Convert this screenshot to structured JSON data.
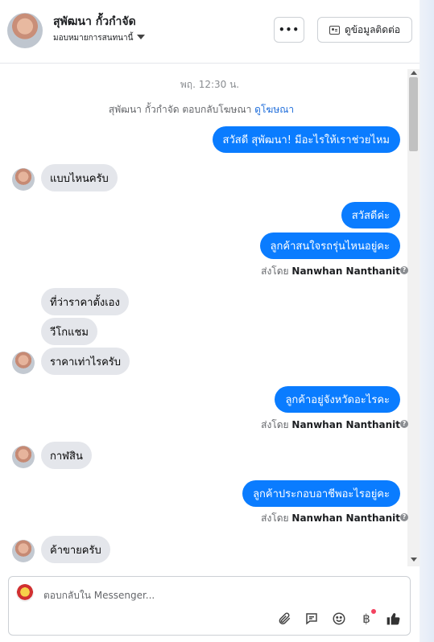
{
  "header": {
    "name": "สุพัฒนา กั้วกำจัด",
    "assign_label": "มอบหมายการสนทนานี้",
    "more_label": "•••",
    "contact_label": "ดูข้อมูลติดต่อ"
  },
  "thread": {
    "timestamp": "พฤ. 12:30 น.",
    "replied_prefix": "สุพัฒนา กั้วกำจัด ตอบกลับโฆษณา",
    "replied_link": "ดูโฆษณา",
    "messages": {
      "m1": "สวัสดี สุพัฒนา! มีอะไรให้เราช่วยไหม",
      "m2": "แบบไหนครับ",
      "m3": "สวัสดีค่ะ",
      "m4": "ลูกค้าสนใจรถรุ่นไหนอยู่คะ",
      "m5": "ที่ว่าราคาตั้งเอง",
      "m6": "วีโกแชม",
      "m7": "ราคาเท่าไรครับ",
      "m8": "ลูกค้าอยู่จังหวัดอะไรคะ",
      "m9": "กาฬสิน",
      "m10": "ลูกค้าประกอบอาชีพอะไรอยู่คะ",
      "m11": "ค้าขายครับ"
    },
    "sent_by_prefix": "ส่งโดย",
    "sent_by_name": "Nanwhan Nanthanit"
  },
  "composer": {
    "placeholder": "ตอบกลับใน Messenger...",
    "tools": [
      "paperclip-icon",
      "chat-bubble-icon",
      "smiley-icon",
      "baht-icon",
      "thumbs-up-icon"
    ]
  },
  "colors": {
    "outgoing_bubble": "#0a7cff",
    "incoming_bubble": "#e4e6eb",
    "link": "#216fdb"
  }
}
